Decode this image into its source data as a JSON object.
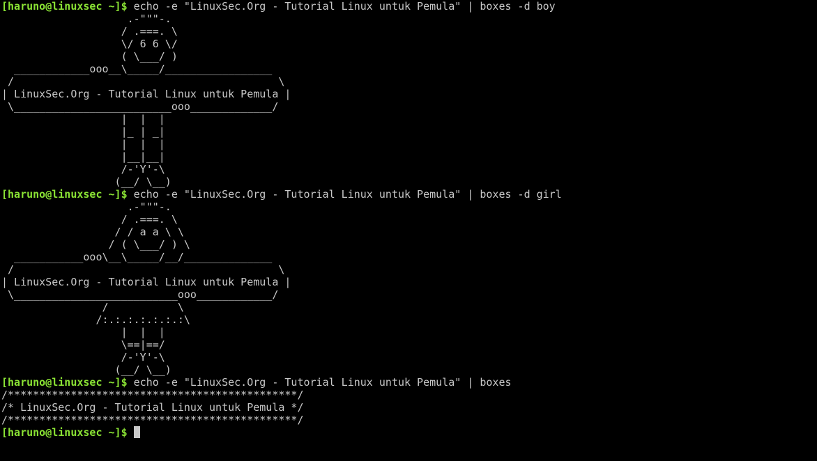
{
  "terminal": {
    "prompt": "[haruno@linuxsec ~]$",
    "blocks": [
      {
        "command": "echo -e \"LinuxSec.Org - Tutorial Linux untuk Pemula\" | boxes -d boy",
        "output": [
          "                    .-\"\"\"-.",
          "                   / .===. \\",
          "                   \\/ 6 6 \\/",
          "                   ( \\___/ )",
          "  ____________ooo__\\_____/_________________",
          " /                                          \\",
          "| LinuxSec.Org - Tutorial Linux untuk Pemula |",
          " \\_________________________ooo_____________/",
          "                   |  |  |",
          "                   |_ | _|",
          "                   |  |  |",
          "                   |__|__|",
          "                   /-'Y'-\\",
          "                  (__/ \\__)"
        ]
      },
      {
        "command": "echo -e \"LinuxSec.Org - Tutorial Linux untuk Pemula\" | boxes -d girl",
        "output": [
          "                    .-\"\"\"-.",
          "                   / .===. \\",
          "                  / / a a \\ \\",
          "                 / ( \\___/ ) \\",
          "  ___________ooo\\__\\_____/__/______________",
          " /                                          \\",
          "| LinuxSec.Org - Tutorial Linux untuk Pemula |",
          " \\__________________________ooo____________/",
          "                /           \\",
          "               /:.:.:.:.:.:.:\\",
          "                   |  |  |",
          "                   \\==|==/",
          "                   /-'Y'-\\",
          "                  (__/ \\__)"
        ]
      },
      {
        "command": "echo -e \"LinuxSec.Org - Tutorial Linux untuk Pemula\" | boxes",
        "output": [
          "/**********************************************/",
          "/* LinuxSec.Org - Tutorial Linux untuk Pemula */",
          "/**********************************************/"
        ]
      }
    ],
    "final_command": ""
  }
}
